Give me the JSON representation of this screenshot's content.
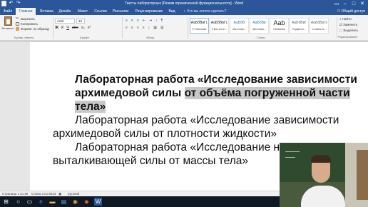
{
  "titlebar": {
    "title": "Тексты лабораторных [Режим ограниченной функциональности] - Word"
  },
  "tabs": [
    {
      "label": "Файл",
      "active": false
    },
    {
      "label": "Главная",
      "active": true
    },
    {
      "label": "Вставка",
      "active": false
    },
    {
      "label": "Дизайн",
      "active": false
    },
    {
      "label": "Макет",
      "active": false
    },
    {
      "label": "Ссылки",
      "active": false
    },
    {
      "label": "Рассылки",
      "active": false
    },
    {
      "label": "Рецензирование",
      "active": false
    },
    {
      "label": "Вид",
      "active": false
    }
  ],
  "help_search": "Что вы хотите сделать?",
  "share": "Общий доступ",
  "clipboard": {
    "paste": "Вставить",
    "cut": "Вырезать",
    "copy": "Копировать",
    "format_painter": "Формат по образцу",
    "group_label": "Буфер обмена"
  },
  "font": {
    "name": "Arial",
    "size": "16",
    "group_label": "Шрифт",
    "format_buttons": [
      "Ж",
      "К",
      "Ч",
      "abc",
      "x₂",
      "x²"
    ]
  },
  "paragraph": {
    "group_label": "Абзац",
    "row1": [
      "≡",
      "≡",
      "≡",
      "⇤",
      "⇥",
      "↕",
      "¶"
    ],
    "row2": [
      "≡",
      "≡",
      "≡",
      "≡",
      "↨",
      "▦",
      "▥"
    ]
  },
  "styles": {
    "group_label": "Стили",
    "items": [
      {
        "sample": "АаБбВвГг,",
        "name": "¶ Обычный",
        "selected": true
      },
      {
        "sample": "АаБбВвГг,",
        "name": "¶ Без инте...",
        "selected": false
      },
      {
        "sample": "АаБбВ",
        "name": "Заголово...",
        "selected": false
      },
      {
        "sample": "АаБбВв",
        "name": "Заголово...",
        "selected": false
      },
      {
        "sample": "Ааb",
        "name": "Название",
        "selected": false
      },
      {
        "sample": "АаБбВвГ",
        "name": "Подзагол...",
        "selected": false
      },
      {
        "sample": "АаБбВвГг",
        "name": "Слабое в...",
        "selected": false
      }
    ]
  },
  "editing": {
    "find": "Найти",
    "replace": "Заменить",
    "select": "Выделить",
    "group_label": "Редактирование"
  },
  "document": {
    "heading_part1": "Лабораторная работа «Исследование зависимости архимедовой силы ",
    "heading_part2": "от объёма погруженной части тела»",
    "para1": "Лабораторная работа «Исследование зависимости архимедовой силы от плотности жидкости»",
    "para2": "Лабораторная работа «Исследование независимости выталкивающей силы от массы тела»"
  },
  "statusbar": {
    "page": "Страница 1 из 30",
    "words": "Слово 3 из 9043",
    "language": "русский"
  },
  "taskbar": {
    "icons": [
      "windows-icon",
      "search-icon",
      "task-view-icon",
      "edge-icon",
      "explorer-icon",
      "store-icon",
      "chrome-icon",
      "app-icon",
      "word-icon"
    ]
  }
}
